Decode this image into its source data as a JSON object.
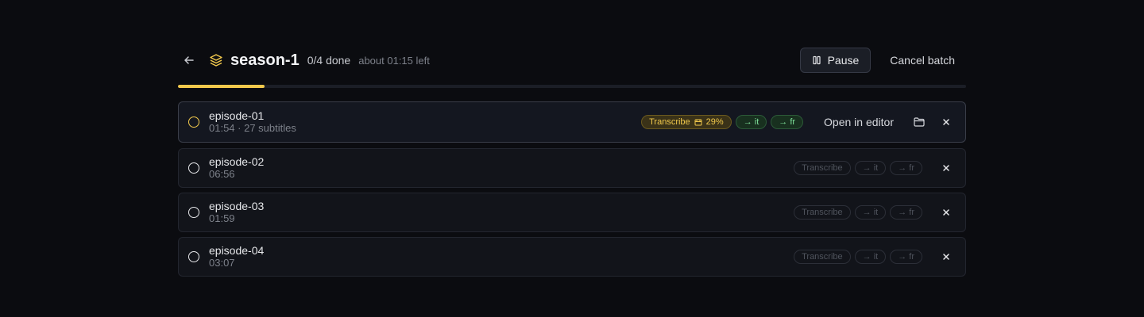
{
  "header": {
    "title": "season-1",
    "done_text": "0/4 done",
    "time_left": "about 01:15 left",
    "pause_label": "Pause",
    "cancel_label": "Cancel batch"
  },
  "progress": {
    "value": 0.11,
    "color": "#f2c94c"
  },
  "episodes": [
    {
      "name": "episode-01",
      "sub": "01:54 · 27 subtitles",
      "active": true,
      "transcribe_label": "Transcribe",
      "transcribe_percent": "29%",
      "lang1": "→ it",
      "lang2": "→ fr",
      "open_label": "Open in editor"
    },
    {
      "name": "episode-02",
      "sub": "06:56",
      "transcribe_label": "Transcribe",
      "lang1": "→ it",
      "lang2": "→ fr"
    },
    {
      "name": "episode-03",
      "sub": "01:59",
      "transcribe_label": "Transcribe",
      "lang1": "→ it",
      "lang2": "→ fr"
    },
    {
      "name": "episode-04",
      "sub": "03:07",
      "transcribe_label": "Transcribe",
      "lang1": "→ it",
      "lang2": "→ fr"
    }
  ],
  "icons": {
    "back": "arrow-left-icon",
    "stack": "layers-icon",
    "pause": "pause-icon",
    "folder": "folder-icon",
    "close": "close-icon",
    "film": "film-icon"
  }
}
